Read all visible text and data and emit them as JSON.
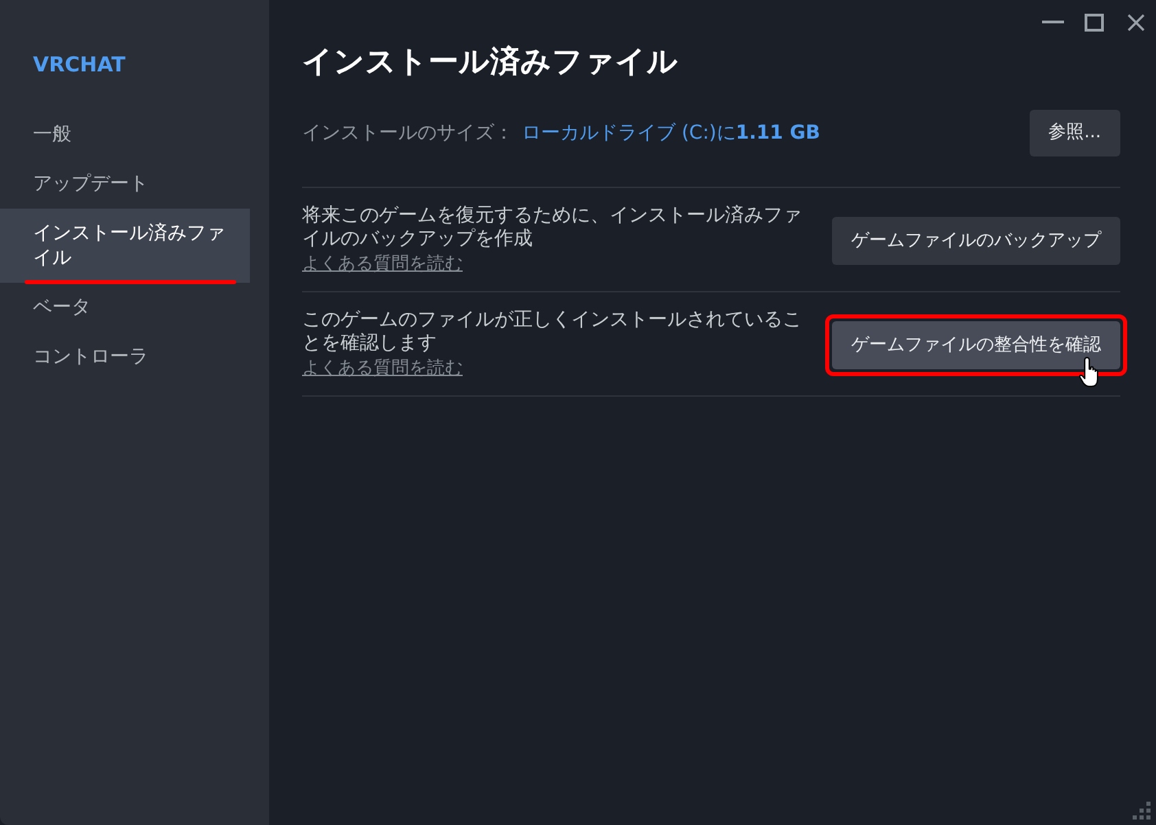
{
  "sidebar": {
    "title": "VRCHAT",
    "items": [
      {
        "label": "一般",
        "selected": false,
        "highlighted": false
      },
      {
        "label": "アップデート",
        "selected": false,
        "highlighted": false
      },
      {
        "label": "インストール済みファイル",
        "selected": true,
        "highlighted": true
      },
      {
        "label": "ベータ",
        "selected": false,
        "highlighted": false
      },
      {
        "label": "コントローラ",
        "selected": false,
        "highlighted": false
      }
    ]
  },
  "page": {
    "title": "インストール済みファイル",
    "install_size": {
      "label": "インストールのサイズ：",
      "value": "ローカルドライブ (C:)に**1.11 GB**",
      "button": "参照..."
    },
    "actions": [
      {
        "description": "将来このゲームを復元するために、インストール済みファイルのバックアップを作成",
        "link": "よくある質問を読む",
        "button": "ゲームファイルのバックアップ",
        "hovered": false,
        "highlighted": false
      },
      {
        "description": "このゲームのファイルが正しくインストールされていることを確認します",
        "link": "よくある質問を読む",
        "button": "ゲームファイルの整合性を確認",
        "hovered": true,
        "highlighted": true
      }
    ]
  }
}
